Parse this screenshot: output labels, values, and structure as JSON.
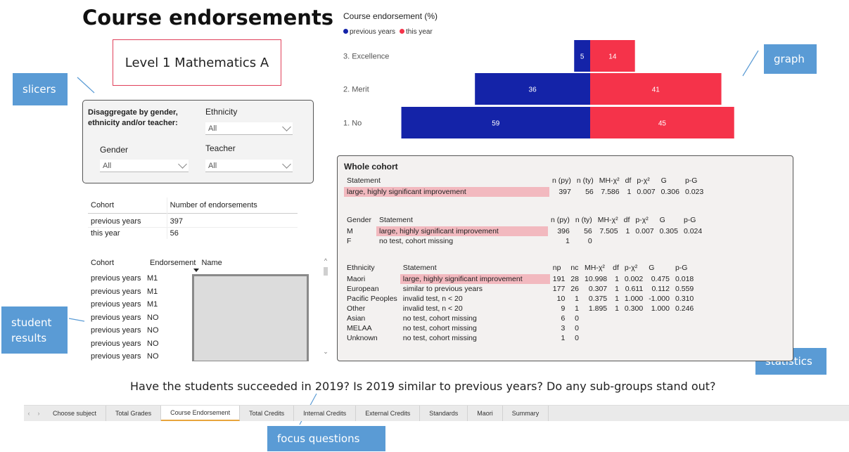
{
  "page": {
    "title": "Course endorsements",
    "subject": "Level 1 Mathematics A",
    "focus_question": "Have the students succeeded in 2019? Is 2019 similar to previous years?  Do any sub-groups stand out?"
  },
  "callouts": {
    "slicers": "slicers",
    "graph": "graph",
    "student_results": "student results",
    "statistics": "statistics",
    "focus_questions": "focus questions"
  },
  "slicers": {
    "heading": "Disaggregate by gender, ethnicity and/or teacher:",
    "ethnicity": {
      "label": "Ethnicity",
      "value": "All"
    },
    "gender": {
      "label": "Gender",
      "value": "All"
    },
    "teacher": {
      "label": "Teacher",
      "value": "All"
    }
  },
  "cohort_table": {
    "headers": [
      "Cohort",
      "Number of endorsements"
    ],
    "rows": [
      {
        "cohort": "previous years",
        "count": "397"
      },
      {
        "cohort": "this year",
        "count": "56"
      }
    ]
  },
  "student_results": {
    "headers": [
      "Cohort",
      "Endorsement",
      "Name"
    ],
    "rows": [
      {
        "cohort": "previous years",
        "endorsement": "M1"
      },
      {
        "cohort": "previous years",
        "endorsement": "M1"
      },
      {
        "cohort": "previous years",
        "endorsement": "M1"
      },
      {
        "cohort": "previous years",
        "endorsement": "NO"
      },
      {
        "cohort": "previous years",
        "endorsement": "NO"
      },
      {
        "cohort": "previous years",
        "endorsement": "NO"
      },
      {
        "cohort": "previous years",
        "endorsement": "NO"
      }
    ]
  },
  "chart_data": {
    "type": "bar",
    "title": "Course endorsement (%)",
    "categories": [
      "3. Excellence",
      "2. Merit",
      "1. No"
    ],
    "series": [
      {
        "name": "previous years",
        "values": [
          5,
          36,
          59
        ],
        "color": "#1423a8"
      },
      {
        "name": "this year",
        "values": [
          14,
          41,
          45
        ],
        "color": "#f5334a"
      }
    ],
    "legend_position": "top-left"
  },
  "stats": {
    "title": "Whole cohort",
    "whole": {
      "headers": [
        "Statement",
        "n (py)",
        "n (ty)",
        "MH-χ²",
        "df",
        "p-χ²",
        "G",
        "p-G"
      ],
      "rows": [
        [
          "large, highly significant improvement",
          "397",
          "56",
          "7.586",
          "1",
          "0.007",
          "0.306",
          "0.023"
        ]
      ]
    },
    "gender": {
      "headers": [
        "Gender",
        "Statement",
        "n (py)",
        "n (ty)",
        "MH-χ²",
        "df",
        "p-χ²",
        "G",
        "p-G"
      ],
      "rows": [
        [
          "M",
          "large, highly significant improvement",
          "396",
          "56",
          "7.505",
          "1",
          "0.007",
          "0.305",
          "0.024"
        ],
        [
          "F",
          "no test, cohort missing",
          "1",
          "0",
          "",
          "",
          "",
          "",
          ""
        ]
      ]
    },
    "ethnicity": {
      "headers": [
        "Ethnicity",
        "Statement",
        "np",
        "nc",
        "MH-χ²",
        "df",
        "p-χ²",
        "G",
        "p-G"
      ],
      "rows": [
        [
          "Maori",
          "large, highly significant improvement",
          "191",
          "28",
          "10.998",
          "1",
          "0.002",
          "0.475",
          "0.018"
        ],
        [
          "European",
          "similar to previous years",
          "177",
          "26",
          "0.307",
          "1",
          "0.611",
          "0.112",
          "0.559"
        ],
        [
          "Pacific Peoples",
          "invalid test, n < 20",
          "10",
          "1",
          "0.375",
          "1",
          "1.000",
          "-1.000",
          "0.310"
        ],
        [
          "Other",
          "invalid test, n < 20",
          "9",
          "1",
          "1.895",
          "1",
          "0.300",
          "1.000",
          "0.246"
        ],
        [
          "Asian",
          "no test, cohort missing",
          "6",
          "0",
          "",
          "",
          "",
          "",
          ""
        ],
        [
          "MELAA",
          "no test, cohort missing",
          "3",
          "0",
          "",
          "",
          "",
          "",
          ""
        ],
        [
          "Unknown",
          "no test, cohort missing",
          "1",
          "0",
          "",
          "",
          "",
          "",
          ""
        ]
      ]
    }
  },
  "tabs": [
    "Choose subject",
    "Total Grades",
    "Course Endorsement",
    "Total Credits",
    "Internal Credits",
    "External Credits",
    "Standards",
    "Maori",
    "Summary"
  ],
  "active_tab": "Course Endorsement",
  "colors": {
    "accent": "#5a9bd5",
    "highlight": "#f2b9bf",
    "prev": "#1423a8",
    "this": "#f5334a"
  }
}
